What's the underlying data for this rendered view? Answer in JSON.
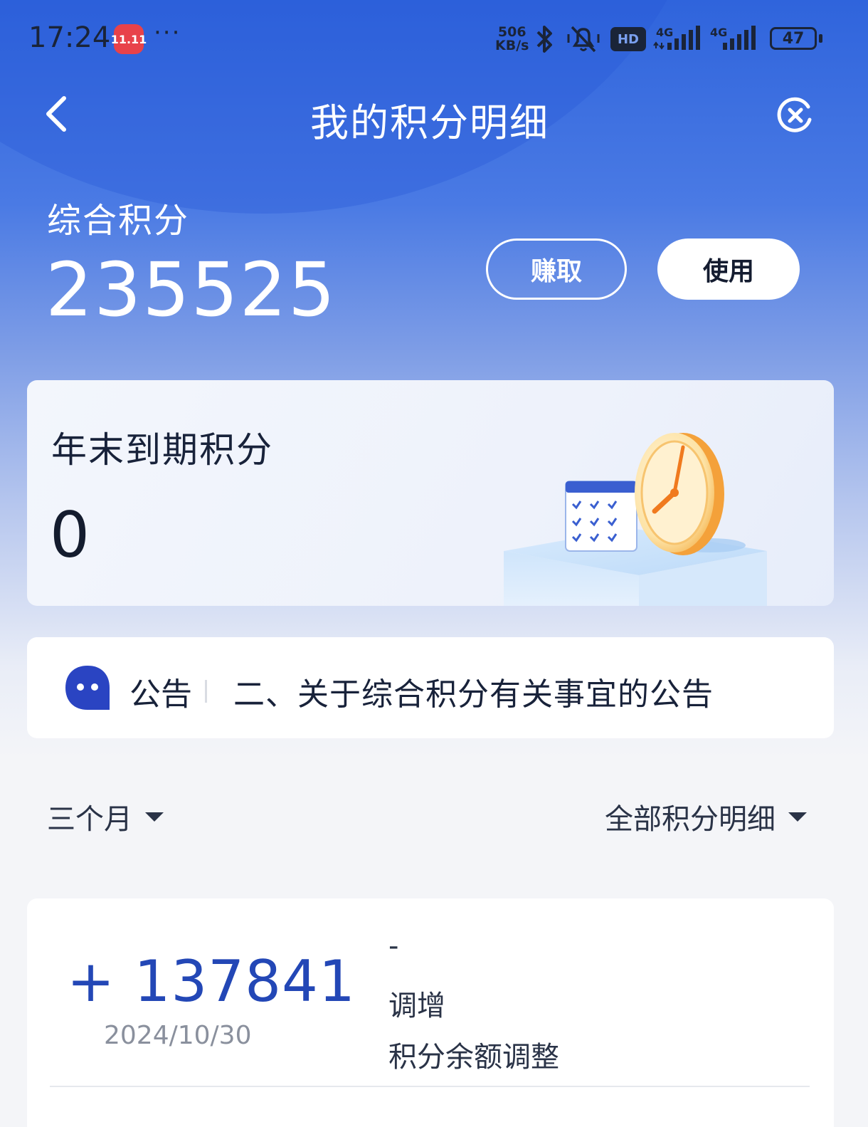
{
  "status_bar": {
    "time": "17:24",
    "app_badge": "11.11",
    "more": "···",
    "net_speed_value": "506",
    "net_speed_unit": "KB/s",
    "hd": "HD",
    "signal_1": "4G",
    "signal_2": "4G",
    "battery": "47"
  },
  "nav": {
    "title": "我的积分明细"
  },
  "points": {
    "label": "综合积分",
    "value": "235525",
    "earn_label": "赚取",
    "use_label": "使用"
  },
  "expire": {
    "label": "年末到期积分",
    "value": "0"
  },
  "notice": {
    "tag": "公告",
    "text": "二、关于综合积分有关事宜的公告"
  },
  "filters": {
    "period": "三个月",
    "type": "全部积分明细"
  },
  "records": [
    {
      "amount": "+ 137841",
      "date": "2024/10/30",
      "dash": "-",
      "type": "调增",
      "desc": "积分余额调整"
    }
  ],
  "colors": {
    "header_blue": "#2f64dc",
    "amount_blue": "#2347b6",
    "accent_orange": "#f5a623"
  }
}
